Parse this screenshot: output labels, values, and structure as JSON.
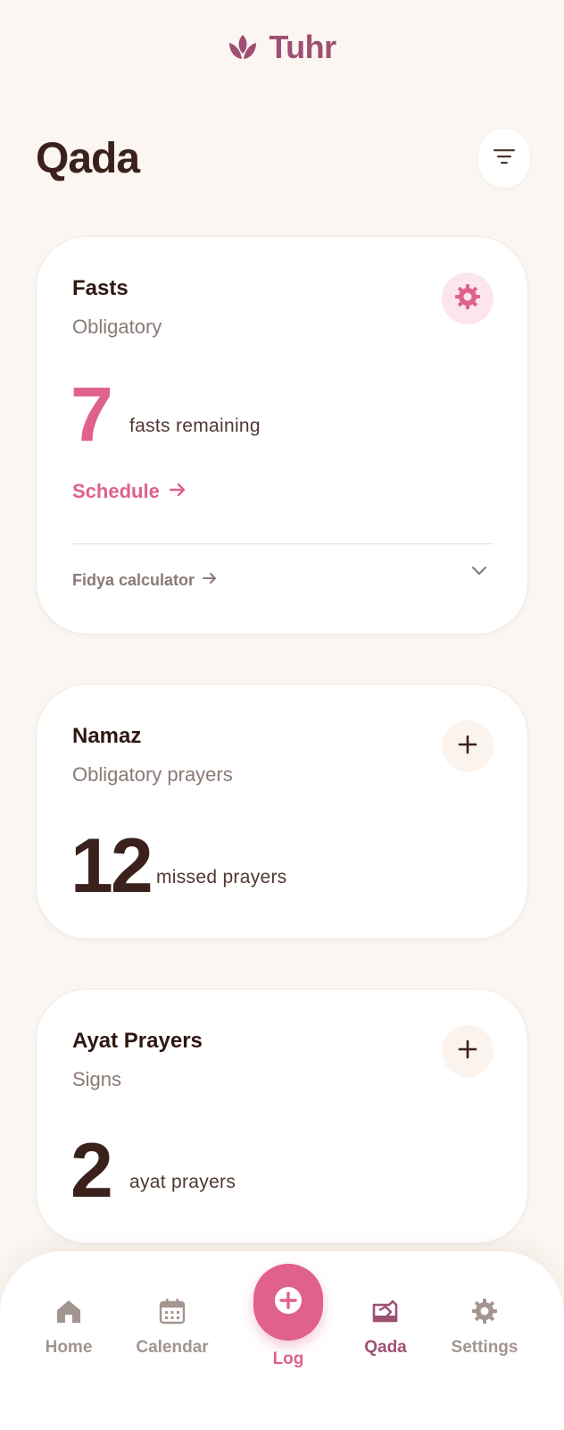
{
  "app": {
    "name": "Tuhr",
    "brand_color": "#9e4f74",
    "accent_color": "#e0608e",
    "logo_icon": "lotus-icon"
  },
  "header": {
    "title": "Qada",
    "filter_icon": "filter-icon"
  },
  "cards": [
    {
      "title": "Fasts",
      "subtitle": "Obligatory",
      "count": "7",
      "count_label": "fasts remaining",
      "count_color": "#e0608e",
      "action_icon": "gear-icon",
      "schedule_label": "Schedule",
      "fidya_label": "Fidya calculator"
    },
    {
      "title": "Namaz",
      "subtitle": "Obligatory prayers",
      "count": "12",
      "count_label": "missed prayers",
      "count_color": "#3b211c",
      "action_icon": "plus-icon"
    },
    {
      "title": "Ayat Prayers",
      "subtitle": "Signs",
      "count": "2",
      "count_label": "ayat prayers",
      "count_color": "#3b211c",
      "action_icon": "plus-icon"
    }
  ],
  "bottom_nav": {
    "items": [
      {
        "label": "Home",
        "icon": "home-icon",
        "active": false
      },
      {
        "label": "Calendar",
        "icon": "calendar-icon",
        "active": false
      },
      {
        "label": "Log",
        "icon": "plus-circle-icon",
        "active": false
      },
      {
        "label": "Qada",
        "icon": "qada-icon",
        "active": true
      },
      {
        "label": "Settings",
        "icon": "gear-icon",
        "active": false
      }
    ]
  }
}
